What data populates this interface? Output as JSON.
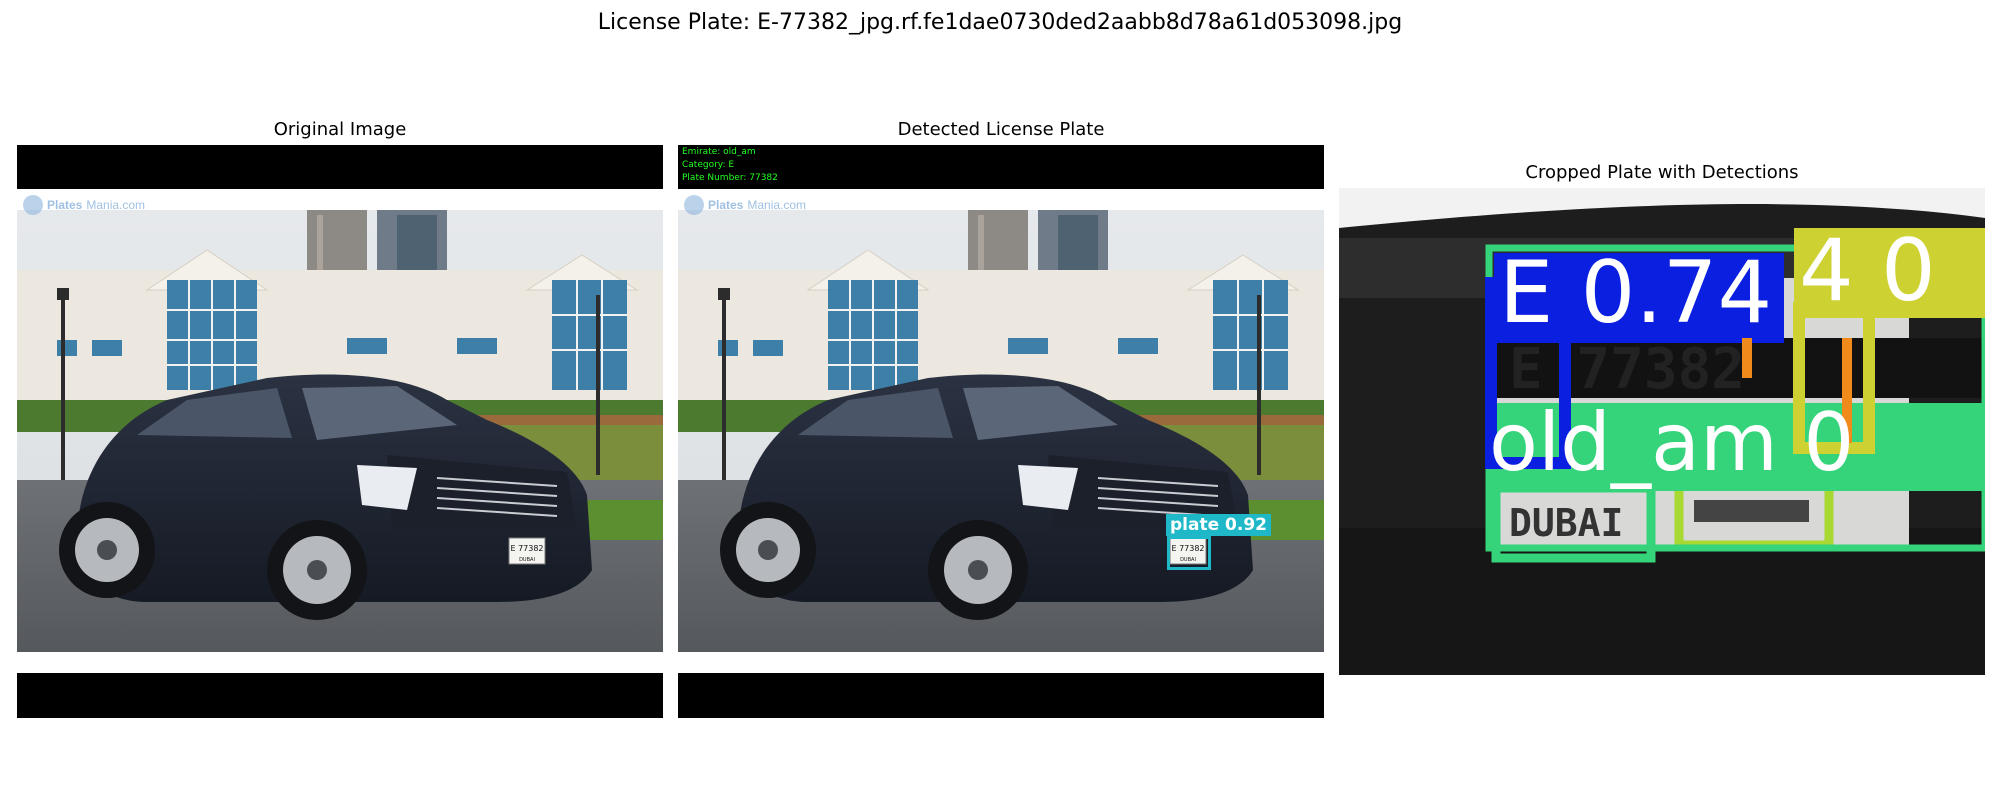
{
  "figure": {
    "suptitle": "License Plate: E-77382_jpg.rf.fe1dae0730ded2aabb8d78a61d053098.jpg"
  },
  "panels": {
    "original": {
      "title": "Original Image",
      "plate_text": "E 77382",
      "plate_subtext": "DUBAI",
      "watermark_brand": "Plates",
      "watermark_site": "Mania.com"
    },
    "detected": {
      "title": "Detected License Plate",
      "info_lines": [
        "Emirate: old_am",
        "Category: E",
        "Plate Number: 77382"
      ],
      "detection_label": "plate",
      "detection_score": "0.92",
      "detection_text": "plate  0.92",
      "detection_color": "#1fb8c8",
      "plate_text": "E 77382",
      "plate_subtext": "DUBAI",
      "watermark_brand": "Plates",
      "watermark_site": "Mania.com"
    },
    "cropped": {
      "title": "Cropped Plate with Detections",
      "labels": {
        "category": "E 0.74",
        "digit": "4 0",
        "emirate": "old_am 0"
      },
      "plate_chars": "E 77382",
      "plate_city": "DUBAI",
      "colors": {
        "blue": "#0b1fe0",
        "green": "#35d37a",
        "yellow": "#cdd131",
        "orange": "#f08a1a",
        "lime": "#a8d832"
      }
    }
  }
}
